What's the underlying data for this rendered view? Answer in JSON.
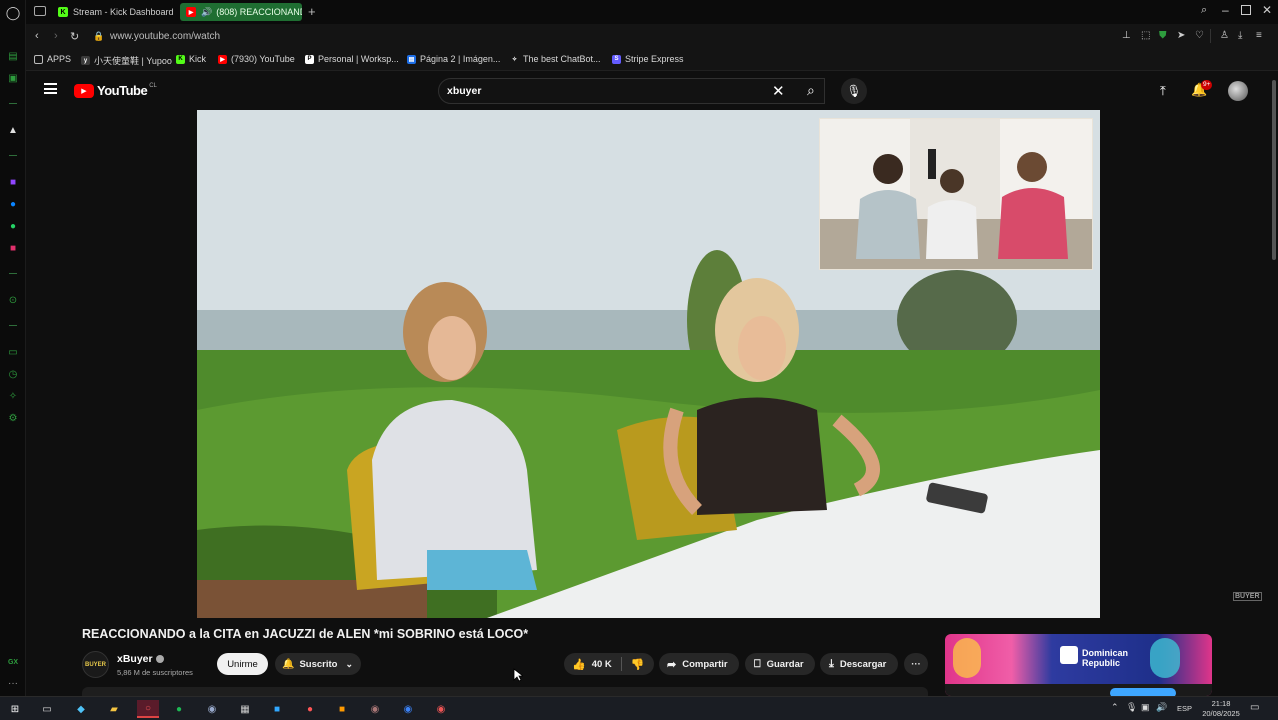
{
  "browser": {
    "tabs": [
      {
        "label": "Stream - Kick Dashboard",
        "favicon": "K",
        "color": "#53fc18"
      },
      {
        "label": "(808) REACCIONANDO",
        "favicon": "▶",
        "color": "#ff0000"
      }
    ],
    "new_tab": "+",
    "url": "www.youtube.com/watch",
    "bookmarks": [
      {
        "label": "APPS",
        "icon": "apps-icon"
      },
      {
        "label": "小天使童鞋 | Yupoo",
        "icon": "yupoo-icon"
      },
      {
        "label": "Kick",
        "icon": "kick-icon"
      },
      {
        "label": "(7930) YouTube",
        "icon": "youtube-icon"
      },
      {
        "label": "Personal | Worksp...",
        "icon": "notion-icon"
      },
      {
        "label": "Página 2 | Imágen...",
        "icon": "freepik-icon"
      },
      {
        "label": "The best ChatBot...",
        "icon": "chatgpt-icon"
      },
      {
        "label": "Stripe Express",
        "icon": "stripe-icon"
      }
    ]
  },
  "youtube": {
    "logo": "YouTube",
    "logo_region": "CL",
    "search_value": "xbuyer",
    "notifications_badge": "9+",
    "video_watermark": "BUYER",
    "video_title": "REACCIONANDO a la CITA en JACUZZI de ALEN *mi SOBRINO está LOCO*",
    "channel_name": "xBuyer",
    "channel_avatar_text": "BUYER",
    "subscribers": "5,86 M de suscriptores",
    "join_label": "Unirme",
    "subscribed_label": "Suscrito",
    "like_count": "40 K",
    "share_label": "Compartir",
    "save_label": "Guardar",
    "download_label": "Descargar",
    "ad_text": "Dominican Republic"
  },
  "taskbar": {
    "language": "ESP",
    "time": "21:18",
    "date": "20/08/2025"
  },
  "colors": {
    "youtube_red": "#ff0000",
    "opera_green": "#2e9d3e",
    "kick_green": "#53fc18"
  }
}
